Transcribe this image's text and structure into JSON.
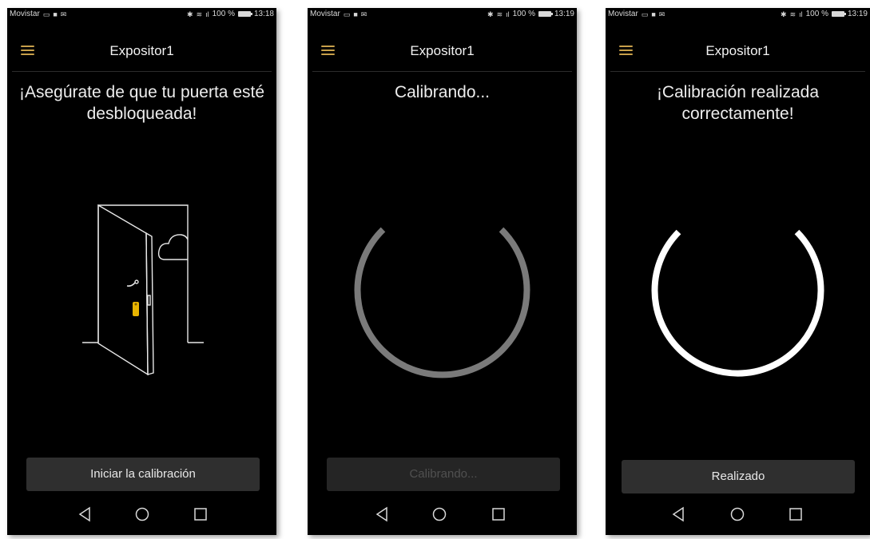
{
  "screens": [
    {
      "status": {
        "carrier": "Movistar",
        "battery": "100 %",
        "time": "13:18"
      },
      "app_title": "Expositor1",
      "headline": "¡Asegúrate de que tu puerta esté desbloqueada!",
      "button_label": "Iniciar la calibración",
      "button_enabled": true
    },
    {
      "status": {
        "carrier": "Movistar",
        "battery": "100 %",
        "time": "13:19"
      },
      "app_title": "Expositor1",
      "headline": "Calibrando...",
      "button_label": "Calibrando...",
      "button_enabled": false
    },
    {
      "status": {
        "carrier": "Movistar",
        "battery": "100 %",
        "time": "13:19"
      },
      "app_title": "Expositor1",
      "headline": "¡Calibración realizada correctamente!",
      "button_label": "Realizado",
      "button_enabled": true
    }
  ],
  "icons": {
    "menu": "hamburger-icon",
    "back": "back-triangle-icon",
    "home": "home-circle-icon",
    "recents": "recents-square-icon"
  },
  "colors": {
    "background": "#000000",
    "accent": "#c8a04a",
    "lock": "#e8b400",
    "ring_progress": "#7a7a7a",
    "ring_done": "#ffffff",
    "button": "#2f2f2f"
  }
}
